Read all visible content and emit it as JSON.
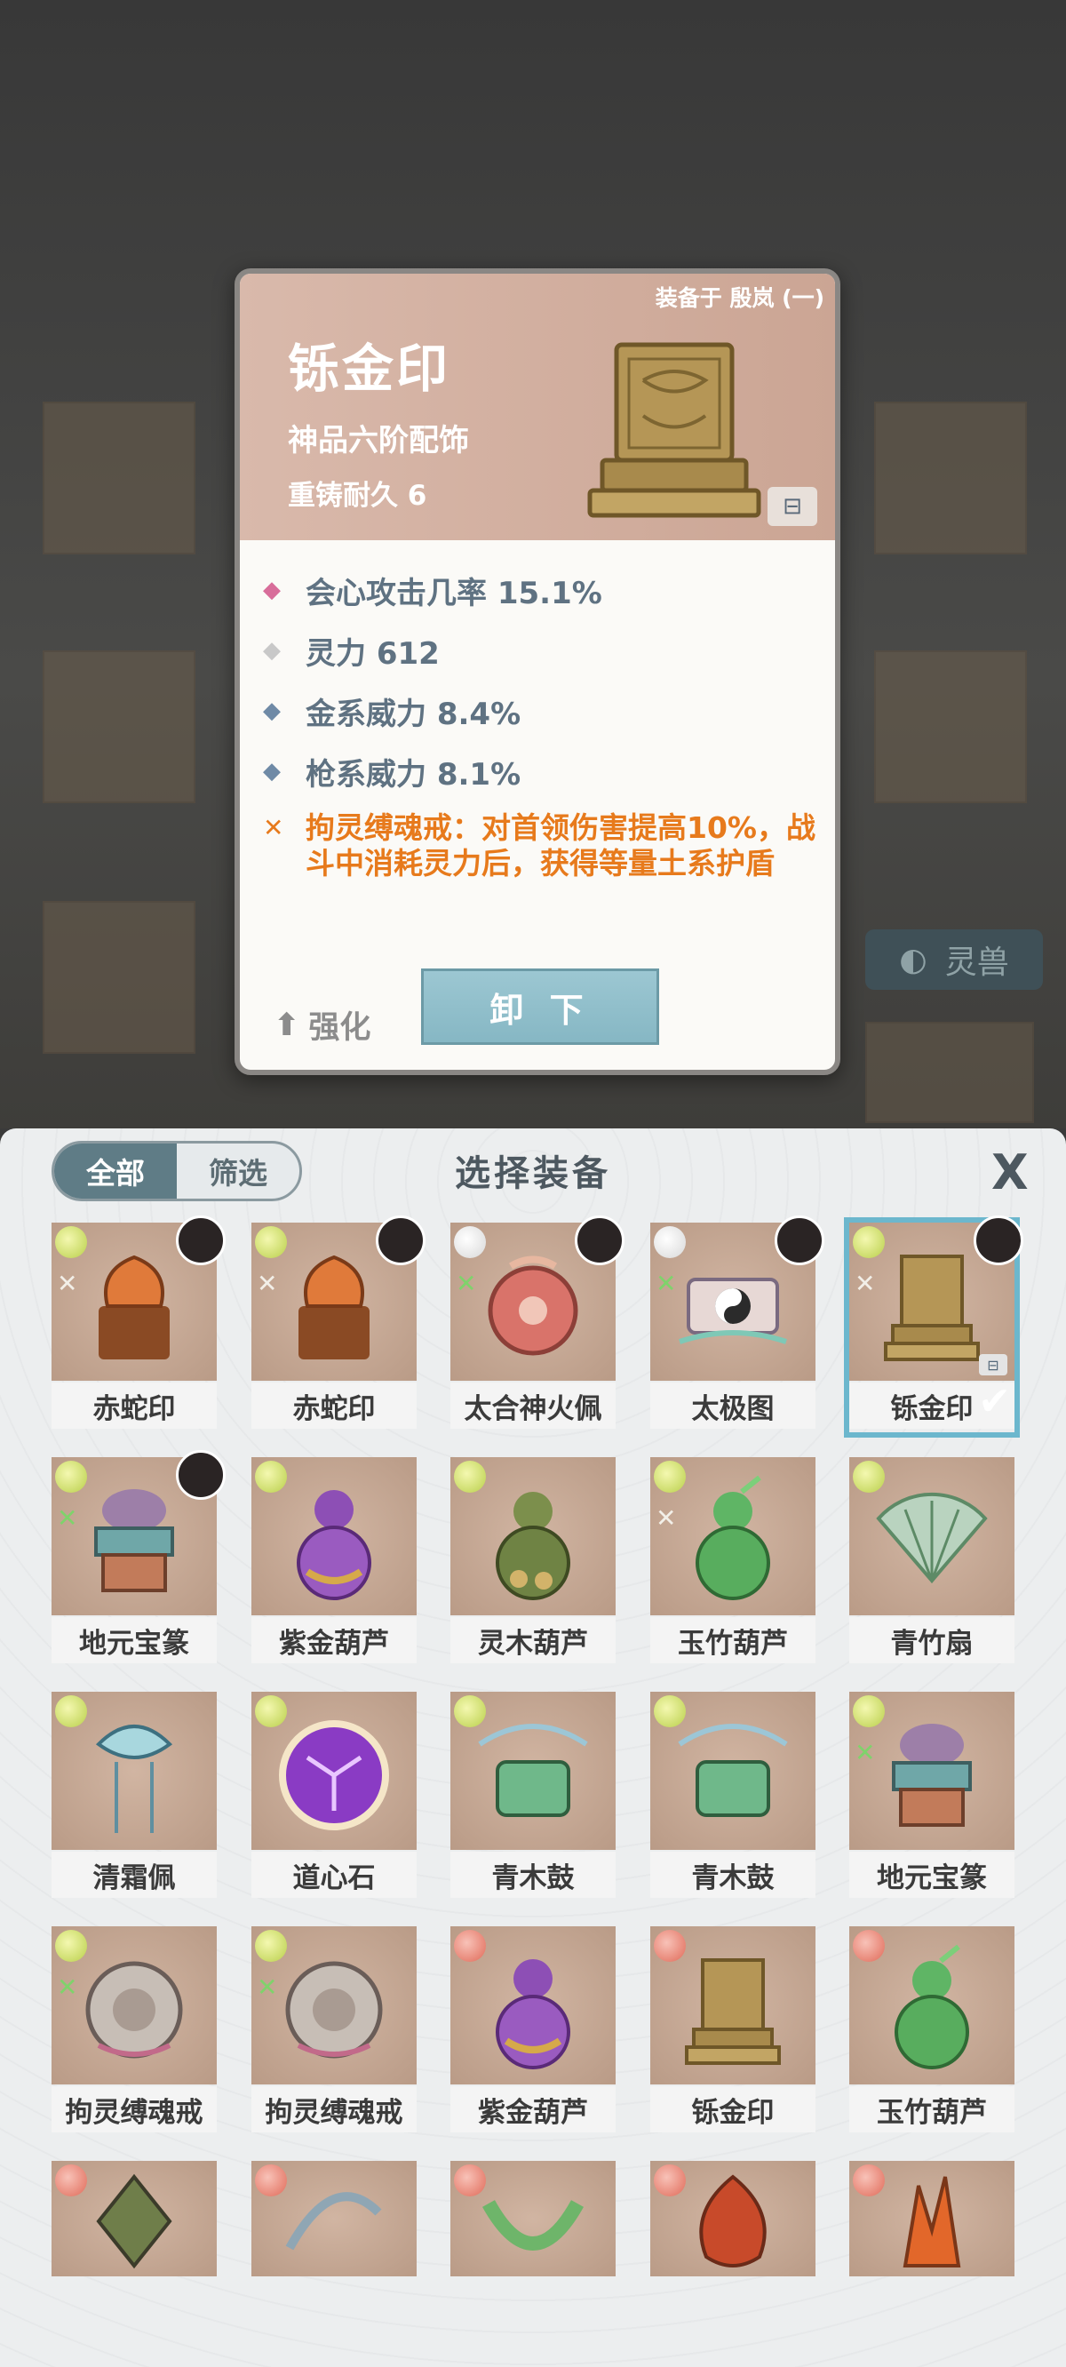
{
  "background": {
    "tab_label": "灵兽"
  },
  "detail": {
    "equipped_by": "装备于 殷岚 (一)",
    "name": "铄金印",
    "grade": "神品六阶配饰",
    "reforge": "重铸耐久 6",
    "stats": [
      {
        "gem": "pink",
        "text": "会心攻击几率 15.1%"
      },
      {
        "gem": "grey",
        "text": "灵力 612"
      },
      {
        "gem": "blue",
        "text": "金系威力 8.4%"
      },
      {
        "gem": "blue",
        "text": "枪系威力 8.1%"
      }
    ],
    "effect": "拘灵缚魂戒：对首领伤害提高10%，战斗中消耗灵力后，获得等量土系护盾",
    "enhance_label": "强化",
    "unequip_label": "卸 下"
  },
  "sheet": {
    "filter_all": "全部",
    "filter_select": "筛选",
    "title": "选择装备",
    "close": "X"
  },
  "colors": {
    "accent": "#6cb7cd",
    "effect": "#e77a1c",
    "stat_text": "#5f7282"
  },
  "items": [
    {
      "label": "赤蛇印",
      "rank": "green",
      "set": "grey",
      "avatar": true,
      "icon": "red-snake-seal"
    },
    {
      "label": "赤蛇印",
      "rank": "green",
      "set": "grey",
      "avatar": true,
      "icon": "red-snake-seal"
    },
    {
      "label": "太合神火佩",
      "rank": "white",
      "set": "green",
      "avatar": true,
      "icon": "fire-jade-pendant"
    },
    {
      "label": "太极图",
      "rank": "white",
      "set": "green",
      "avatar": true,
      "icon": "taiji-scroll"
    },
    {
      "label": "铄金印",
      "rank": "green",
      "set": "grey",
      "avatar": true,
      "icon": "golden-seal",
      "selected": true
    },
    {
      "label": "地元宝篆",
      "rank": "green",
      "set": "green",
      "avatar": true,
      "icon": "incense-burner"
    },
    {
      "label": "紫金葫芦",
      "rank": "green",
      "icon": "purple-gourd"
    },
    {
      "label": "灵木葫芦",
      "rank": "green",
      "icon": "wood-gourd"
    },
    {
      "label": "玉竹葫芦",
      "rank": "green",
      "set": "grey",
      "icon": "jade-gourd"
    },
    {
      "label": "青竹扇",
      "rank": "green",
      "icon": "bamboo-fan"
    },
    {
      "label": "清霜佩",
      "rank": "green",
      "icon": "frost-pendant"
    },
    {
      "label": "道心石",
      "rank": "green",
      "icon": "dao-stone"
    },
    {
      "label": "青木鼓",
      "rank": "green",
      "icon": "wood-drum"
    },
    {
      "label": "青木鼓",
      "rank": "green",
      "icon": "wood-drum"
    },
    {
      "label": "地元宝篆",
      "rank": "green",
      "set": "green",
      "icon": "incense-burner"
    },
    {
      "label": "拘灵缚魂戒",
      "rank": "green",
      "set": "green",
      "icon": "spirit-ring"
    },
    {
      "label": "拘灵缚魂戒",
      "rank": "green",
      "set": "green",
      "icon": "spirit-ring"
    },
    {
      "label": "紫金葫芦",
      "rank": "red",
      "icon": "purple-gourd"
    },
    {
      "label": "铄金印",
      "rank": "red",
      "icon": "golden-seal"
    },
    {
      "label": "玉竹葫芦",
      "rank": "red",
      "icon": "jade-gourd"
    },
    {
      "label": "",
      "rank": "red",
      "icon": "amulet"
    },
    {
      "label": "",
      "rank": "red",
      "icon": "branch-ring"
    },
    {
      "label": "",
      "rank": "red",
      "icon": "jade-ring"
    },
    {
      "label": "",
      "rank": "red",
      "icon": "flame-pendant"
    },
    {
      "label": "",
      "rank": "red",
      "icon": "fire-crystal"
    }
  ]
}
